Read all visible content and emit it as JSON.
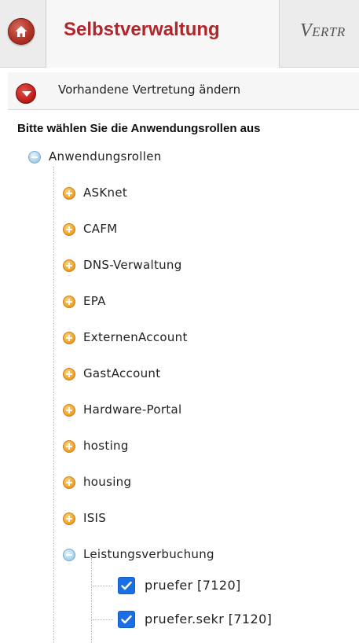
{
  "header": {
    "active_tab": "Selbstverwaltung",
    "next_tab": "Vertr"
  },
  "subaction": {
    "label": "Vorhandene Vertretung ändern"
  },
  "instruction": "Bitte wählen Sie die Anwendungsrollen aus",
  "tree": {
    "root": {
      "label": "Anwendungsrollen",
      "expanded": true
    },
    "items": [
      {
        "label": "ASKnet",
        "expanded": false
      },
      {
        "label": "CAFM",
        "expanded": false
      },
      {
        "label": "DNS-Verwaltung",
        "expanded": false
      },
      {
        "label": "EPA",
        "expanded": false
      },
      {
        "label": "ExternenAccount",
        "expanded": false
      },
      {
        "label": "GastAccount",
        "expanded": false
      },
      {
        "label": "Hardware-Portal",
        "expanded": false
      },
      {
        "label": "hosting",
        "expanded": false
      },
      {
        "label": "housing",
        "expanded": false
      },
      {
        "label": "ISIS",
        "expanded": false
      },
      {
        "label": "Leistungsverbuchung",
        "expanded": true
      }
    ],
    "leaves": [
      {
        "label": "pruefer [7120]",
        "checked": true
      },
      {
        "label": "pruefer.sekr [7120]",
        "checked": true
      }
    ]
  },
  "colors": {
    "accent_red": "#b0262a",
    "checkbox_blue": "#1b6fe0",
    "expand_orange": "#f2a52c",
    "collapse_blue": "#a9d2ea"
  }
}
